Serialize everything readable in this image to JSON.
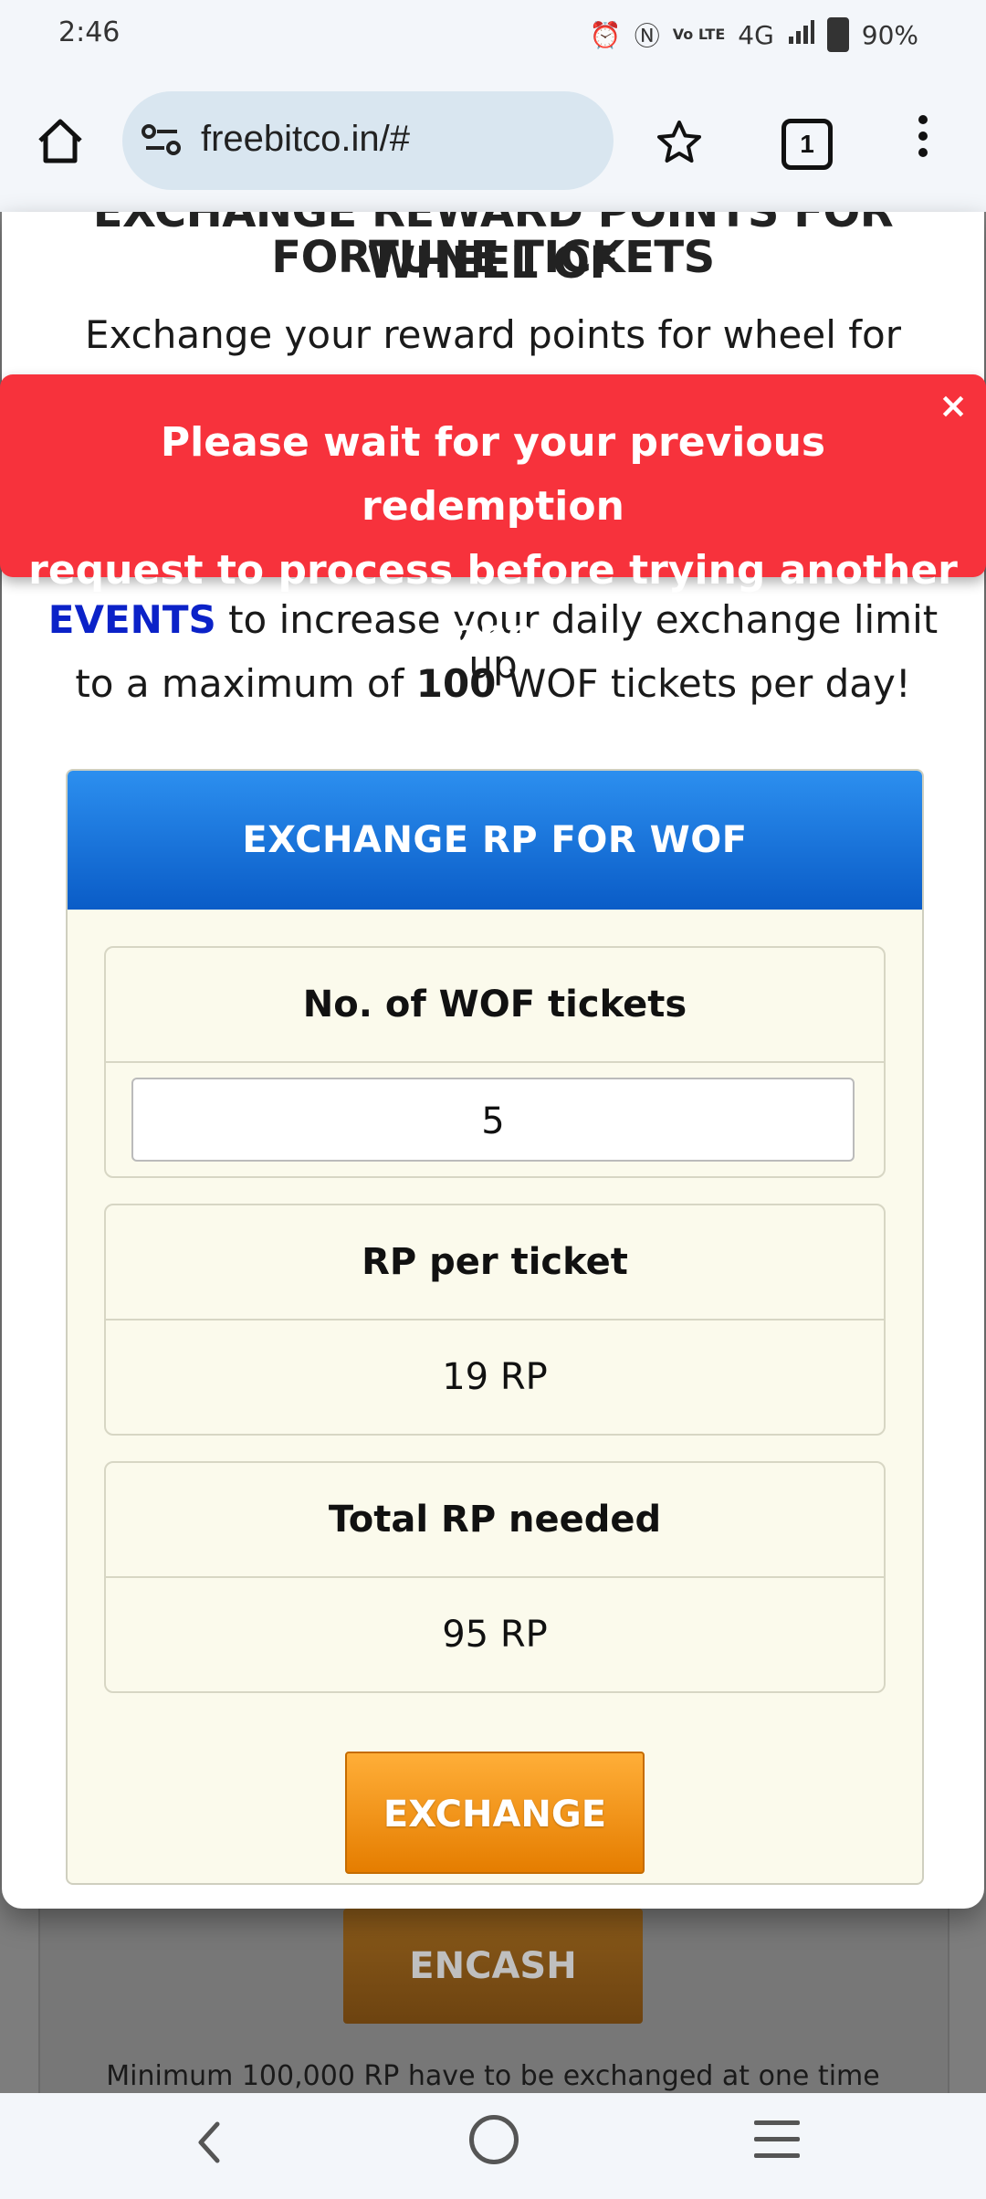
{
  "status_bar": {
    "time": "2:46",
    "network_label": "4G",
    "volte_label": "Vo LTE",
    "battery": "90%"
  },
  "browser": {
    "url": "freebitco.in/#",
    "tab_count": "1"
  },
  "modal": {
    "title_line1": "EXCHANGE REWARD POINTS FOR WHEEL OF",
    "title_line2": "FORTUNE TICKETS",
    "intro_line": "Exchange your reward points for wheel for",
    "events_word": "EVENTS",
    "events_rest": " to increase your daily exchange limit up",
    "limit_prefix": "to a maximum of ",
    "limit_value": "100",
    "limit_suffix": " WOF tickets per day!"
  },
  "exchange_box": {
    "header": "EXCHANGE RP FOR WOF",
    "tickets_label": "No. of WOF tickets",
    "tickets_value": "5",
    "rp_per_ticket_label": "RP per ticket",
    "rp_per_ticket_value": "19 RP",
    "total_label": "Total RP needed",
    "total_value": "95 RP",
    "button_label": "EXCHANGE"
  },
  "alert": {
    "message_line1": "Please wait for your previous redemption",
    "message_line2": "request to process before trying another one",
    "close_symbol": "×"
  },
  "background_page": {
    "encash_label": "ENCASH",
    "note": "Minimum 100,000 RP have to be exchanged at one time"
  },
  "colors": {
    "alert_red": "#f7323c",
    "header_blue": "#0a5cc7",
    "button_orange": "#e57d00",
    "events_blue": "#0b22c8"
  }
}
